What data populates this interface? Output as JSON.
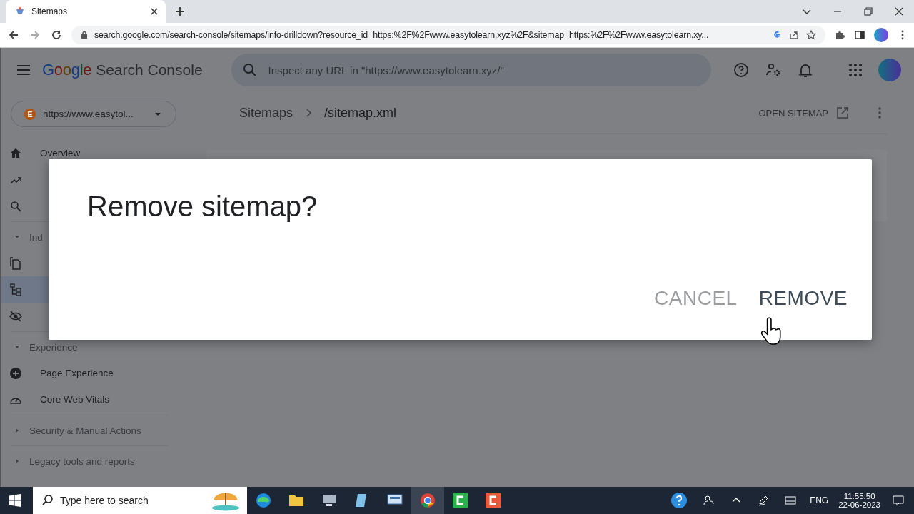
{
  "browser": {
    "tab": {
      "title": "Sitemaps"
    },
    "url": "search.google.com/search-console/sitemaps/info-drilldown?resource_id=https:%2F%2Fwww.easytolearn.xyz%2F&sitemap=https:%2F%2Fwww.easytolearn.xy..."
  },
  "header": {
    "brand": "Google",
    "product": "Search Console",
    "search": {
      "placeholder": "Inspect any URL in \"https://www.easytolearn.xyz/\""
    }
  },
  "property": {
    "badge": "E",
    "label": "https://www.easytol..."
  },
  "breadcrumb": [
    "Sitemaps",
    "/sitemap.xml"
  ],
  "open_sitemap": "OPEN SITEMAP",
  "nav_top": [
    {
      "kind": "labeled",
      "label": "Overview"
    },
    {
      "kind": "icon_only"
    },
    {
      "kind": "icon_only"
    }
  ],
  "sections": [
    {
      "label": "Ind",
      "expanded": true,
      "items": [
        {
          "kind": "icon_only",
          "selected": false
        },
        {
          "kind": "icon_only",
          "selected": true
        },
        {
          "kind": "icon_only",
          "selected": false
        }
      ]
    },
    {
      "label": "Experience",
      "expanded": true,
      "items": [
        {
          "kind": "labeled",
          "label": "Page Experience",
          "selected": false
        },
        {
          "kind": "labeled",
          "label": "Core Web Vitals",
          "selected": false
        }
      ]
    },
    {
      "label": "Security & Manual Actions",
      "expanded": false
    },
    {
      "label": "Legacy tools and reports",
      "expanded": false
    }
  ],
  "dialog": {
    "title": "Remove sitemap?",
    "buttons": [
      {
        "label": "CANCEL",
        "kind": "secondary"
      },
      {
        "label": "REMOVE",
        "kind": "primary"
      }
    ]
  },
  "taskbar": {
    "search": {
      "placeholder": "Type here to search"
    },
    "language": "ENG",
    "time": "11:55:50",
    "date": "22-06-2023"
  }
}
